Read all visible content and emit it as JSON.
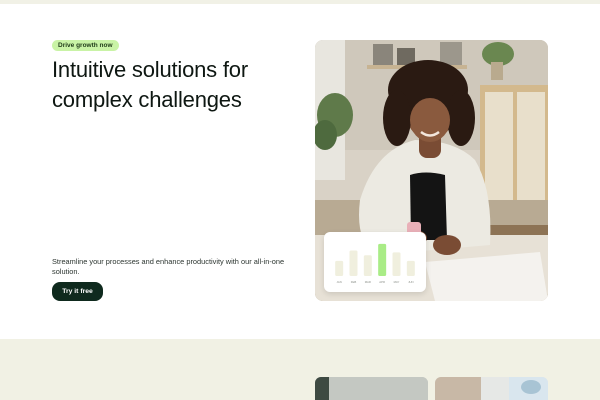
{
  "hero": {
    "badge": "Drive growth now",
    "title": "Intuitive solutions for complex challenges",
    "description": "Streamline your processes and enhance productivity with our all-in-one solution.",
    "cta_label": "Try it free"
  },
  "chart_data": {
    "type": "bar",
    "categories": [
      "JAN",
      "FEB",
      "MAR",
      "APR",
      "MAY",
      "JUN"
    ],
    "values": [
      16,
      27,
      22,
      34,
      25,
      16
    ],
    "highlight_index": 3,
    "title": "",
    "xlabel": "",
    "ylabel": "",
    "ylim": [
      0,
      36
    ],
    "grid": false,
    "colors": {
      "bar": "#f0efde",
      "highlight": "#a9ec86"
    }
  },
  "colors": {
    "accent": "#c9f3a6",
    "button": "#0f2a1e",
    "band": "#f1f1e4"
  }
}
